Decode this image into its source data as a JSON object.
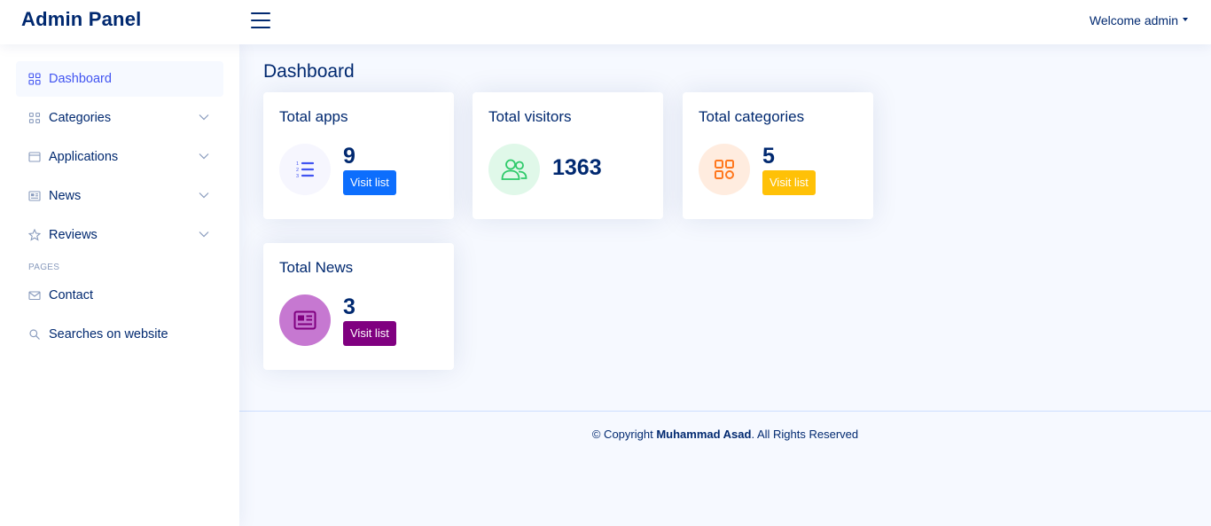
{
  "header": {
    "logo": "Admin Panel",
    "welcome": "Welcome admin"
  },
  "sidebar": {
    "items": [
      {
        "label": "Dashboard",
        "icon": "grid-icon",
        "active": true
      },
      {
        "label": "Categories",
        "icon": "grid-icon",
        "expandable": true
      },
      {
        "label": "Applications",
        "icon": "window-icon",
        "expandable": true
      },
      {
        "label": "News",
        "icon": "newspaper-icon",
        "expandable": true
      },
      {
        "label": "Reviews",
        "icon": "star-icon",
        "expandable": true
      }
    ],
    "pages_heading": "PAGES",
    "pages": [
      {
        "label": "Contact",
        "icon": "envelope-icon"
      },
      {
        "label": "Searches on website",
        "icon": "search-icon"
      }
    ]
  },
  "main": {
    "title": "Dashboard",
    "cards": [
      {
        "title": "Total apps",
        "value": "9",
        "button": "Visit list",
        "icon": "list-ol-icon",
        "icon_color": "#4154f1",
        "circle_color": "#f6f6fe",
        "button_color": "#0d6efd"
      },
      {
        "title": "Total visitors",
        "value": "1363",
        "icon": "people-icon",
        "icon_color": "#2eca6a",
        "circle_color": "#e0f8e9"
      },
      {
        "title": "Total categories",
        "value": "5",
        "button": "Visit list",
        "icon": "grid-icon",
        "icon_color": "#ff771d",
        "circle_color": "#ffecdf",
        "button_color": "#ffc107"
      },
      {
        "title": "Total News",
        "value": "3",
        "button": "Visit list",
        "icon": "newspaper-icon",
        "icon_color": "#800080",
        "circle_color": "#c678d1",
        "button_color": "#800080"
      }
    ]
  },
  "footer": {
    "prefix": "© Copyright ",
    "author": "Muhammad Asad",
    "suffix": ". All Rights Reserved"
  }
}
